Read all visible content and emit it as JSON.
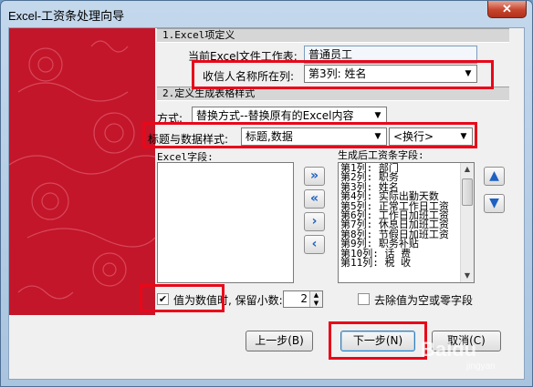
{
  "window": {
    "title": "Excel-工资条处理向导",
    "close_glyph": "✕"
  },
  "sections": {
    "excel_def": "1.Excel项定义",
    "style_def": "2.定义生成表格样式"
  },
  "fields": {
    "current_sheet_label": "当前Excel文件工作表:",
    "current_sheet_value": "普通员工",
    "recipient_col_label": "收信人名称所在列:",
    "recipient_col_value": "第3列: 姓名",
    "method_label": "方式:",
    "method_value": "替换方式--替换原有的Excel内容",
    "title_style_label": "标题与数据样式:",
    "title_style_value": "标题,数据",
    "separator_value": "<换行>",
    "excel_fields_label": "Excel字段:",
    "generated_fields_label": "生成后工资条字段:"
  },
  "generated_fields": [
    "第1列: 部门",
    "第2列: 职务",
    "第3列: 姓名",
    "第4列: 实际出勤天数",
    "第5列: 正常工作日工资",
    "第6列: 工作日加班工资",
    "第7列: 休息日加班工资",
    "第8列: 节假日加班工资",
    "第9列: 职务补贴",
    "第10列: 话 费",
    "第11列: 税 收"
  ],
  "transfer_buttons": {
    "add_all": "»",
    "remove_all": "«",
    "add_one": "›",
    "remove_one": "‹"
  },
  "move_buttons": {
    "up": "▲",
    "down": "▼"
  },
  "options": {
    "numeric_label": "值为数值时, 保留小数:",
    "numeric_checked": "✔",
    "decimals": "2",
    "remove_empty_label": "去除值为空或零字段"
  },
  "buttons": {
    "prev": "上一步(B)",
    "next": "下一步(N)",
    "cancel": "取消(C)"
  },
  "watermark": {
    "text": "Baidu",
    "sub": "jingyan"
  },
  "colors": {
    "highlight": "#e8081a",
    "side_panel": "#c3162a",
    "arrow_blue": "#1d61c3"
  }
}
